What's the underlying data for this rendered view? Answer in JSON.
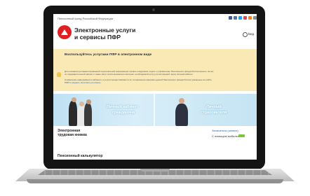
{
  "site": {
    "org_name": "Пенсионный фонд Российской Федерации",
    "title_line1": "Электронные услуги",
    "title_line2": "и сервисы ПФР",
    "version_label": "Вид"
  },
  "banner": {
    "title": "Воспользуйтесь услугами ПФР в электронном виде",
    "text_lines": [
      "Для оказания регламентированной персональной информации органа в кадровом отделе и управлению Пенсионного фонда России вашего лично",
      "по предварительной записи и также могут воспользоваться интернет необходимой услугу регистрацией через личный кабинет.",
      "Справочная информация в кабинете и услуги предоставляются по телефонным каналам единой Пенсионного фонда России указанные на сайте",
      "ПФР в разделе «Контакты региона»."
    ]
  },
  "hero": {
    "left_label_1": "Личный кабинет",
    "left_label_2": "гражданина",
    "right_label_1": "Личный",
    "right_label_2": "страхователя"
  },
  "sections": {
    "left_title_1": "Электронная",
    "left_title_2": "трудовая книжка",
    "link_register": "Записаться (записи)",
    "link_live": "С помощью мобильного",
    "bottom_title": "Пенсионный калькулятор"
  },
  "social_colors": [
    "#3b5998",
    "#4a76a8",
    "#1da1f2",
    "#e4405f",
    "#f0822a",
    "#888888",
    "#cccccc"
  ]
}
